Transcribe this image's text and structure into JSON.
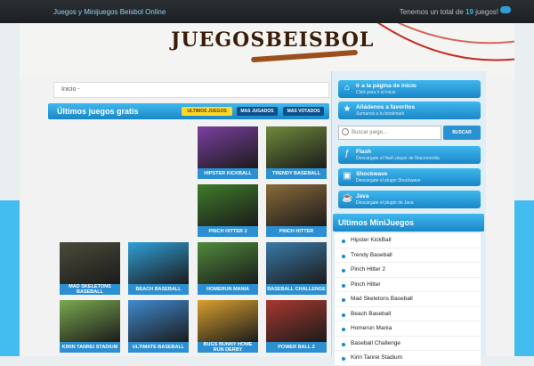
{
  "topbar": {
    "site_name": "Juegos y Minijuegos Beisbol Online",
    "total_prefix": "Tenemos un total de",
    "total_count": "19",
    "total_suffix": "juegos!"
  },
  "logo": {
    "text": "JUEGOSBEISBOL"
  },
  "breadcrumb": {
    "label": "Inicio -"
  },
  "games_section": {
    "title": "Últimos juegos gratis",
    "tabs": [
      "ULTIMOS JUEGOS",
      "MAS JUGADOS",
      "MAS VOTADOS"
    ],
    "tiles": [
      {
        "label": "HIPSTER KICKBALL",
        "color": "#7b3fa0"
      },
      {
        "label": "TRENDY BASEBALL",
        "color": "#6f8a3b"
      },
      {
        "label": "PINCH HITTER 2",
        "color": "#3f7b2a"
      },
      {
        "label": "PINCH HITTER",
        "color": "#8a6a3b"
      },
      {
        "label": "MAD SKELETONS BASEBALL",
        "color": "#4b4b3a"
      },
      {
        "label": "BEACH BASEBALL",
        "color": "#2f9fd8"
      },
      {
        "label": "HOMERUN MANIA",
        "color": "#4f8a3b"
      },
      {
        "label": "BASEBALL CHALLENGE",
        "color": "#3a7aa8"
      },
      {
        "label": "KIRIN TANREI STADIUM",
        "color": "#7aa84f"
      },
      {
        "label": "ULTIMATE BASEBALL",
        "color": "#3f8ad1"
      },
      {
        "label": "BUGS BUNNY HOME RUN DERBY",
        "color": "#d8a02f"
      },
      {
        "label": "POWER BALL 2",
        "color": "#a8382f"
      }
    ]
  },
  "sidebar": {
    "buttons": [
      {
        "title": "Ir a la página de inicio",
        "subtitle": "Click para ir al inicio",
        "icon": "home-icon"
      },
      {
        "title": "Añádenos a favoritos",
        "subtitle": "Sumanos a tu bookmark",
        "icon": "bookmark-icon"
      }
    ],
    "search": {
      "placeholder": "Buscar juego...",
      "button": "BUSCAR"
    },
    "plugins": [
      {
        "title": "Flash",
        "subtitle": "Descargate el flash player de Macromedia",
        "icon": "flash-icon"
      },
      {
        "title": "Shockwave",
        "subtitle": "Descargate el plugin Shockwave",
        "icon": "shockwave-icon"
      },
      {
        "title": "Java",
        "subtitle": "Descargate el plugin de Java",
        "icon": "java-icon"
      }
    ],
    "mini_title": "Ultimos MiniJuegos",
    "mini_items": [
      "Hipster KickBall",
      "Trendy Baseball",
      "Pinch Hitter 2",
      "Pinch Hitter",
      "Mad Skeletons Baseball",
      "Beach Baseball",
      "Homerun Mania",
      "Baseball Challenge",
      "Kirin Tanrei Stadium"
    ]
  },
  "colors": {
    "accent": "#1a86c7",
    "stripe": "#43bdf0",
    "tab_active": "#ffd62a"
  }
}
